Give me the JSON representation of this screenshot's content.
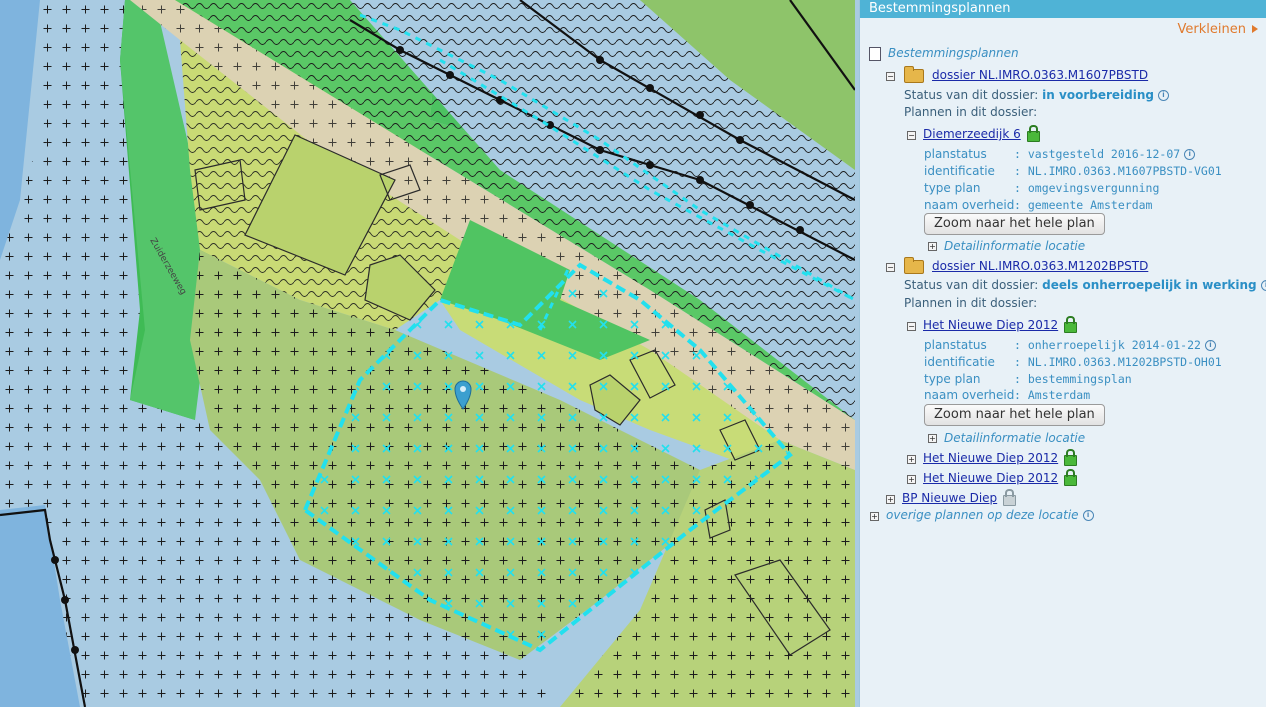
{
  "panel": {
    "header_title": "Bestemmingsplannen",
    "collapse_label": "Verkleinen",
    "root_label": "Bestemmingsplannen",
    "dossiers": [
      {
        "title": "dossier NL.IMRO.0363.M1607PBSTD",
        "status_label": "Status van dit dossier:",
        "status_value": "in voorbereiding",
        "plans_label": "Plannen in dit dossier:",
        "plan": {
          "name": "Diemerzeedijk 6",
          "props": [
            {
              "key": "planstatus",
              "value": ": vastgesteld 2016-12-07"
            },
            {
              "key": "identificatie",
              "value": ": NL.IMRO.0363.M1607PBSTD-VG01"
            },
            {
              "key": "type plan",
              "value": ": omgevingsvergunning"
            },
            {
              "key": "naam overheid",
              "value": ": gemeente Amsterdam"
            }
          ],
          "zoom_label": "Zoom naar het hele plan",
          "detail_label": "Detailinformatie locatie"
        }
      },
      {
        "title": "dossier NL.IMRO.0363.M1202BPSTD",
        "status_label": "Status van dit dossier:",
        "status_value": "deels onherroepelijk in werking",
        "plans_label": "Plannen in dit dossier:",
        "plan": {
          "name": "Het Nieuwe Diep 2012",
          "props": [
            {
              "key": "planstatus",
              "value": ": onherroepelijk 2014-01-22"
            },
            {
              "key": "identificatie",
              "value": ": NL.IMRO.0363.M1202BPSTD-OH01"
            },
            {
              "key": "type plan",
              "value": ": bestemmingsplan"
            },
            {
              "key": "naam overheid",
              "value": ": Amsterdam"
            }
          ],
          "zoom_label": "Zoom naar het hele plan",
          "detail_label": "Detailinformatie locatie"
        },
        "extra_plans": [
          "Het Nieuwe Diep 2012",
          "Het Nieuwe Diep 2012"
        ]
      }
    ],
    "bp_label": "BP Nieuwe Diep",
    "other_label": "overige plannen op deze locatie"
  },
  "map": {
    "street_label": "Zuiderzeeweg",
    "colors": {
      "water": "#a9cbe2",
      "dark_water": "#6fa9d8",
      "green": "#65c46a",
      "light_green": "#c3d97a",
      "mid_green": "#a9c97a",
      "dike": "#d9cfb0",
      "selection": "#22e0ee",
      "marker": "#3b9fcf"
    },
    "icons": [
      "location-pin-icon"
    ]
  }
}
